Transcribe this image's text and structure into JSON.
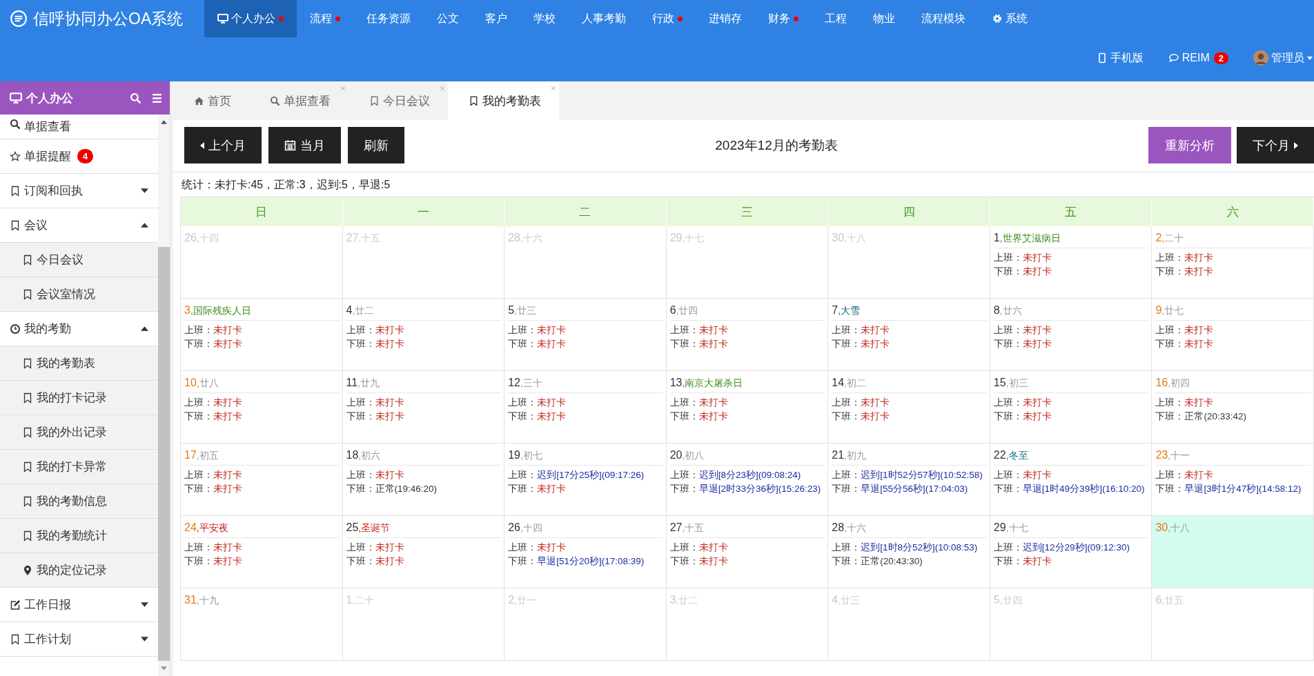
{
  "app_title": "信呼协同办公OA系统",
  "nav": [
    {
      "label": "个人办公",
      "selected": true,
      "dot": true
    },
    {
      "label": "流程",
      "selected": false,
      "dot": true
    },
    {
      "label": "任务资源",
      "selected": false,
      "dot": false
    },
    {
      "label": "公文",
      "selected": false,
      "dot": false
    },
    {
      "label": "客户",
      "selected": false,
      "dot": false
    },
    {
      "label": "学校",
      "selected": false,
      "dot": false
    },
    {
      "label": "人事考勤",
      "selected": false,
      "dot": false
    },
    {
      "label": "行政",
      "selected": false,
      "dot": true
    },
    {
      "label": "进销存",
      "selected": false,
      "dot": false
    },
    {
      "label": "财务",
      "selected": false,
      "dot": true
    },
    {
      "label": "工程",
      "selected": false,
      "dot": false
    },
    {
      "label": "物业",
      "selected": false,
      "dot": false
    },
    {
      "label": "流程模块",
      "selected": false,
      "dot": false
    },
    {
      "label": "系统",
      "selected": false,
      "dot": false
    }
  ],
  "top_right": {
    "mobile": "手机版",
    "chat": "REIM",
    "chat_badge": "2",
    "user": "管理员"
  },
  "sidebar": {
    "title": "个人办公",
    "items": [
      {
        "label": "单据查看"
      },
      {
        "label": "单据提醒",
        "badge": "4"
      },
      {
        "label": "订阅和回执",
        "expanded": false
      },
      {
        "label": "会议",
        "expanded": true,
        "children": [
          {
            "label": "今日会议"
          },
          {
            "label": "会议室情况"
          }
        ]
      },
      {
        "label": "我的考勤",
        "expanded": true,
        "children": [
          {
            "label": "我的考勤表"
          },
          {
            "label": "我的打卡记录"
          },
          {
            "label": "我的外出记录"
          },
          {
            "label": "我的打卡异常"
          },
          {
            "label": "我的考勤信息"
          },
          {
            "label": "我的考勤统计"
          },
          {
            "label": "我的定位记录"
          }
        ]
      },
      {
        "label": "工作日报",
        "expanded": false
      },
      {
        "label": "工作计划",
        "expanded": false
      }
    ]
  },
  "tabs": [
    {
      "label": "首页",
      "selected": false,
      "closable": false
    },
    {
      "label": "单据查看",
      "selected": false,
      "closable": true
    },
    {
      "label": "今日会议",
      "selected": false,
      "closable": true
    },
    {
      "label": "我的考勤表",
      "selected": true,
      "closable": true
    }
  ],
  "toolbar": {
    "prev": "上个月",
    "current": "当月",
    "refresh": "刷新",
    "title": "2023年12月的考勤表",
    "reanalyze": "重新分析",
    "next": "下个月"
  },
  "stats": "统计：未打卡:45，正常:3，迟到:5，早退:5",
  "weekdays": [
    "日",
    "一",
    "二",
    "三",
    "四",
    "五",
    "六"
  ],
  "days": [
    {
      "day": "26",
      "kind": "other",
      "label": {
        "text": ",十四",
        "kind": "lunar"
      },
      "today": false
    },
    {
      "day": "27",
      "kind": "other",
      "label": {
        "text": ",十五",
        "kind": "lunar"
      },
      "today": false
    },
    {
      "day": "28",
      "kind": "other",
      "label": {
        "text": ",十六",
        "kind": "lunar"
      },
      "today": false
    },
    {
      "day": "29",
      "kind": "other",
      "label": {
        "text": ",十七",
        "kind": "lunar"
      },
      "today": false
    },
    {
      "day": "30",
      "kind": "other",
      "label": {
        "text": ",十八",
        "kind": "lunar"
      },
      "today": false
    },
    {
      "day": "1",
      "kind": "weekday",
      "label": {
        "text": ",世界艾滋病日",
        "kind": "festival"
      },
      "today": false,
      "records": [
        {
          "label": "上班：",
          "value": "未打卡",
          "kind": "missing"
        },
        {
          "label": "下班：",
          "value": "未打卡",
          "kind": "missing"
        }
      ]
    },
    {
      "day": "2",
      "kind": "weekend",
      "label": {
        "text": ",二十",
        "kind": "lunar"
      },
      "today": false,
      "records": [
        {
          "label": "上班：",
          "value": "未打卡",
          "kind": "missing"
        },
        {
          "label": "下班：",
          "value": "未打卡",
          "kind": "missing"
        }
      ]
    },
    {
      "day": "3",
      "kind": "weekend",
      "label": {
        "text": ",国际残疾人日",
        "kind": "festival"
      },
      "today": false,
      "records": [
        {
          "label": "上班：",
          "value": "未打卡",
          "kind": "missing"
        },
        {
          "label": "下班：",
          "value": "未打卡",
          "kind": "missing"
        }
      ]
    },
    {
      "day": "4",
      "kind": "weekday",
      "label": {
        "text": ",廿二",
        "kind": "lunar"
      },
      "today": false,
      "records": [
        {
          "label": "上班：",
          "value": "未打卡",
          "kind": "missing"
        },
        {
          "label": "下班：",
          "value": "未打卡",
          "kind": "missing"
        }
      ]
    },
    {
      "day": "5",
      "kind": "weekday",
      "label": {
        "text": ",廿三",
        "kind": "lunar"
      },
      "today": false,
      "records": [
        {
          "label": "上班：",
          "value": "未打卡",
          "kind": "missing"
        },
        {
          "label": "下班：",
          "value": "未打卡",
          "kind": "missing"
        }
      ]
    },
    {
      "day": "6",
      "kind": "weekday",
      "label": {
        "text": ",廿四",
        "kind": "lunar"
      },
      "today": false,
      "records": [
        {
          "label": "上班：",
          "value": "未打卡",
          "kind": "missing"
        },
        {
          "label": "下班：",
          "value": "未打卡",
          "kind": "missing"
        }
      ]
    },
    {
      "day": "7",
      "kind": "weekday",
      "label": {
        "text": ",大雪",
        "kind": "term"
      },
      "today": false,
      "records": [
        {
          "label": "上班：",
          "value": "未打卡",
          "kind": "missing"
        },
        {
          "label": "下班：",
          "value": "未打卡",
          "kind": "missing"
        }
      ]
    },
    {
      "day": "8",
      "kind": "weekday",
      "label": {
        "text": ",廿六",
        "kind": "lunar"
      },
      "today": false,
      "records": [
        {
          "label": "上班：",
          "value": "未打卡",
          "kind": "missing"
        },
        {
          "label": "下班：",
          "value": "未打卡",
          "kind": "missing"
        }
      ]
    },
    {
      "day": "9",
      "kind": "weekend",
      "label": {
        "text": ",廿七",
        "kind": "lunar"
      },
      "today": false,
      "records": [
        {
          "label": "上班：",
          "value": "未打卡",
          "kind": "missing"
        },
        {
          "label": "下班：",
          "value": "未打卡",
          "kind": "missing"
        }
      ]
    },
    {
      "day": "10",
      "kind": "weekend",
      "label": {
        "text": ",廿八",
        "kind": "lunar"
      },
      "today": false,
      "records": [
        {
          "label": "上班：",
          "value": "未打卡",
          "kind": "missing"
        },
        {
          "label": "下班：",
          "value": "未打卡",
          "kind": "missing"
        }
      ]
    },
    {
      "day": "11",
      "kind": "weekday",
      "label": {
        "text": ",廿九",
        "kind": "lunar"
      },
      "today": false,
      "records": [
        {
          "label": "上班：",
          "value": "未打卡",
          "kind": "missing"
        },
        {
          "label": "下班：",
          "value": "未打卡",
          "kind": "missing"
        }
      ]
    },
    {
      "day": "12",
      "kind": "weekday",
      "label": {
        "text": ",三十",
        "kind": "lunar"
      },
      "today": false,
      "records": [
        {
          "label": "上班：",
          "value": "未打卡",
          "kind": "missing"
        },
        {
          "label": "下班：",
          "value": "未打卡",
          "kind": "missing"
        }
      ]
    },
    {
      "day": "13",
      "kind": "weekday",
      "label": {
        "text": ",南京大屠杀日",
        "kind": "festival"
      },
      "today": false,
      "records": [
        {
          "label": "上班：",
          "value": "未打卡",
          "kind": "missing"
        },
        {
          "label": "下班：",
          "value": "未打卡",
          "kind": "missing"
        }
      ]
    },
    {
      "day": "14",
      "kind": "weekday",
      "label": {
        "text": ",初二",
        "kind": "lunar"
      },
      "today": false,
      "records": [
        {
          "label": "上班：",
          "value": "未打卡",
          "kind": "missing"
        },
        {
          "label": "下班：",
          "value": "未打卡",
          "kind": "missing"
        }
      ]
    },
    {
      "day": "15",
      "kind": "weekday",
      "label": {
        "text": ",初三",
        "kind": "lunar"
      },
      "today": false,
      "records": [
        {
          "label": "上班：",
          "value": "未打卡",
          "kind": "missing"
        },
        {
          "label": "下班：",
          "value": "未打卡",
          "kind": "missing"
        }
      ]
    },
    {
      "day": "16",
      "kind": "weekend",
      "label": {
        "text": ",初四",
        "kind": "lunar"
      },
      "today": false,
      "records": [
        {
          "label": "上班：",
          "value": "未打卡",
          "kind": "missing"
        },
        {
          "label": "下班：",
          "value": "正常(20:33:42)",
          "kind": "normal"
        }
      ]
    },
    {
      "day": "17",
      "kind": "weekend",
      "label": {
        "text": ",初五",
        "kind": "lunar"
      },
      "today": false,
      "records": [
        {
          "label": "上班：",
          "value": "未打卡",
          "kind": "missing"
        },
        {
          "label": "下班：",
          "value": "未打卡",
          "kind": "missing"
        }
      ]
    },
    {
      "day": "18",
      "kind": "weekday",
      "label": {
        "text": ",初六",
        "kind": "lunar"
      },
      "today": false,
      "records": [
        {
          "label": "上班：",
          "value": "未打卡",
          "kind": "missing"
        },
        {
          "label": "下班：",
          "value": "正常(19:46:20)",
          "kind": "normal"
        }
      ]
    },
    {
      "day": "19",
      "kind": "weekday",
      "label": {
        "text": ",初七",
        "kind": "lunar"
      },
      "today": false,
      "records": [
        {
          "label": "上班：",
          "value": "迟到[17分25秒](09:17:26)",
          "kind": "abnormal"
        },
        {
          "label": "下班：",
          "value": "未打卡",
          "kind": "missing"
        }
      ]
    },
    {
      "day": "20",
      "kind": "weekday",
      "label": {
        "text": ",初八",
        "kind": "lunar"
      },
      "today": false,
      "records": [
        {
          "label": "上班：",
          "value": "迟到[8分23秒](09:08:24)",
          "kind": "abnormal"
        },
        {
          "label": "下班：",
          "value": "早退[2时33分36秒](15:26:23)",
          "kind": "abnormal"
        }
      ]
    },
    {
      "day": "21",
      "kind": "weekday",
      "label": {
        "text": ",初九",
        "kind": "lunar"
      },
      "today": false,
      "records": [
        {
          "label": "上班：",
          "value": "迟到[1时52分57秒](10:52:58)",
          "kind": "abnormal"
        },
        {
          "label": "下班：",
          "value": "早退[55分56秒](17:04:03)",
          "kind": "abnormal"
        }
      ]
    },
    {
      "day": "22",
      "kind": "weekday",
      "label": {
        "text": ",冬至",
        "kind": "term"
      },
      "today": false,
      "records": [
        {
          "label": "上班：",
          "value": "未打卡",
          "kind": "missing"
        },
        {
          "label": "下班：",
          "value": "早退[1时49分39秒](16:10:20)",
          "kind": "abnormal"
        }
      ]
    },
    {
      "day": "23",
      "kind": "weekend",
      "label": {
        "text": ",十一",
        "kind": "lunar"
      },
      "today": false,
      "records": [
        {
          "label": "上班：",
          "value": "未打卡",
          "kind": "missing"
        },
        {
          "label": "下班：",
          "value": "早退[3时1分47秒](14:58:12)",
          "kind": "abnormal"
        }
      ]
    },
    {
      "day": "24",
      "kind": "weekend",
      "label": {
        "text": ",平安夜",
        "kind": "holiday"
      },
      "today": false,
      "records": [
        {
          "label": "上班：",
          "value": "未打卡",
          "kind": "missing"
        },
        {
          "label": "下班：",
          "value": "未打卡",
          "kind": "missing"
        }
      ]
    },
    {
      "day": "25",
      "kind": "weekday",
      "label": {
        "text": ",圣诞节",
        "kind": "holiday"
      },
      "today": false,
      "records": [
        {
          "label": "上班：",
          "value": "未打卡",
          "kind": "missing"
        },
        {
          "label": "下班：",
          "value": "未打卡",
          "kind": "missing"
        }
      ]
    },
    {
      "day": "26",
      "kind": "weekday",
      "label": {
        "text": ",十四",
        "kind": "lunar"
      },
      "today": false,
      "records": [
        {
          "label": "上班：",
          "value": "未打卡",
          "kind": "missing"
        },
        {
          "label": "下班：",
          "value": "早退[51分20秒](17:08:39)",
          "kind": "abnormal"
        }
      ]
    },
    {
      "day": "27",
      "kind": "weekday",
      "label": {
        "text": ",十五",
        "kind": "lunar"
      },
      "today": false,
      "records": [
        {
          "label": "上班：",
          "value": "未打卡",
          "kind": "missing"
        },
        {
          "label": "下班：",
          "value": "未打卡",
          "kind": "missing"
        }
      ]
    },
    {
      "day": "28",
      "kind": "weekday",
      "label": {
        "text": ",十六",
        "kind": "lunar"
      },
      "today": false,
      "records": [
        {
          "label": "上班：",
          "value": "迟到[1时8分52秒](10:08:53)",
          "kind": "abnormal"
        },
        {
          "label": "下班：",
          "value": "正常(20:43:30)",
          "kind": "normal"
        }
      ]
    },
    {
      "day": "29",
      "kind": "weekday",
      "label": {
        "text": ",十七",
        "kind": "lunar"
      },
      "today": false,
      "records": [
        {
          "label": "上班：",
          "value": "迟到[12分29秒](09:12:30)",
          "kind": "abnormal"
        },
        {
          "label": "下班：",
          "value": "未打卡",
          "kind": "missing"
        }
      ]
    },
    {
      "day": "30",
      "kind": "weekend",
      "label": {
        "text": ",十八",
        "kind": "lunar"
      },
      "today": true
    },
    {
      "day": "31",
      "kind": "weekend",
      "label": {
        "text": ",十九",
        "kind": "lunar"
      },
      "today": false
    },
    {
      "day": "1",
      "kind": "other",
      "label": {
        "text": ",二十",
        "kind": "lunar"
      },
      "today": false
    },
    {
      "day": "2",
      "kind": "other",
      "label": {
        "text": ",廿一",
        "kind": "lunar"
      },
      "today": false
    },
    {
      "day": "3",
      "kind": "other",
      "label": {
        "text": ",廿二",
        "kind": "lunar"
      },
      "today": false
    },
    {
      "day": "4",
      "kind": "other",
      "label": {
        "text": ",廿三",
        "kind": "lunar"
      },
      "today": false
    },
    {
      "day": "5",
      "kind": "other",
      "label": {
        "text": ",廿四",
        "kind": "lunar"
      },
      "today": false
    },
    {
      "day": "6",
      "kind": "other",
      "label": {
        "text": ",廿五",
        "kind": "lunar"
      },
      "today": false
    }
  ]
}
